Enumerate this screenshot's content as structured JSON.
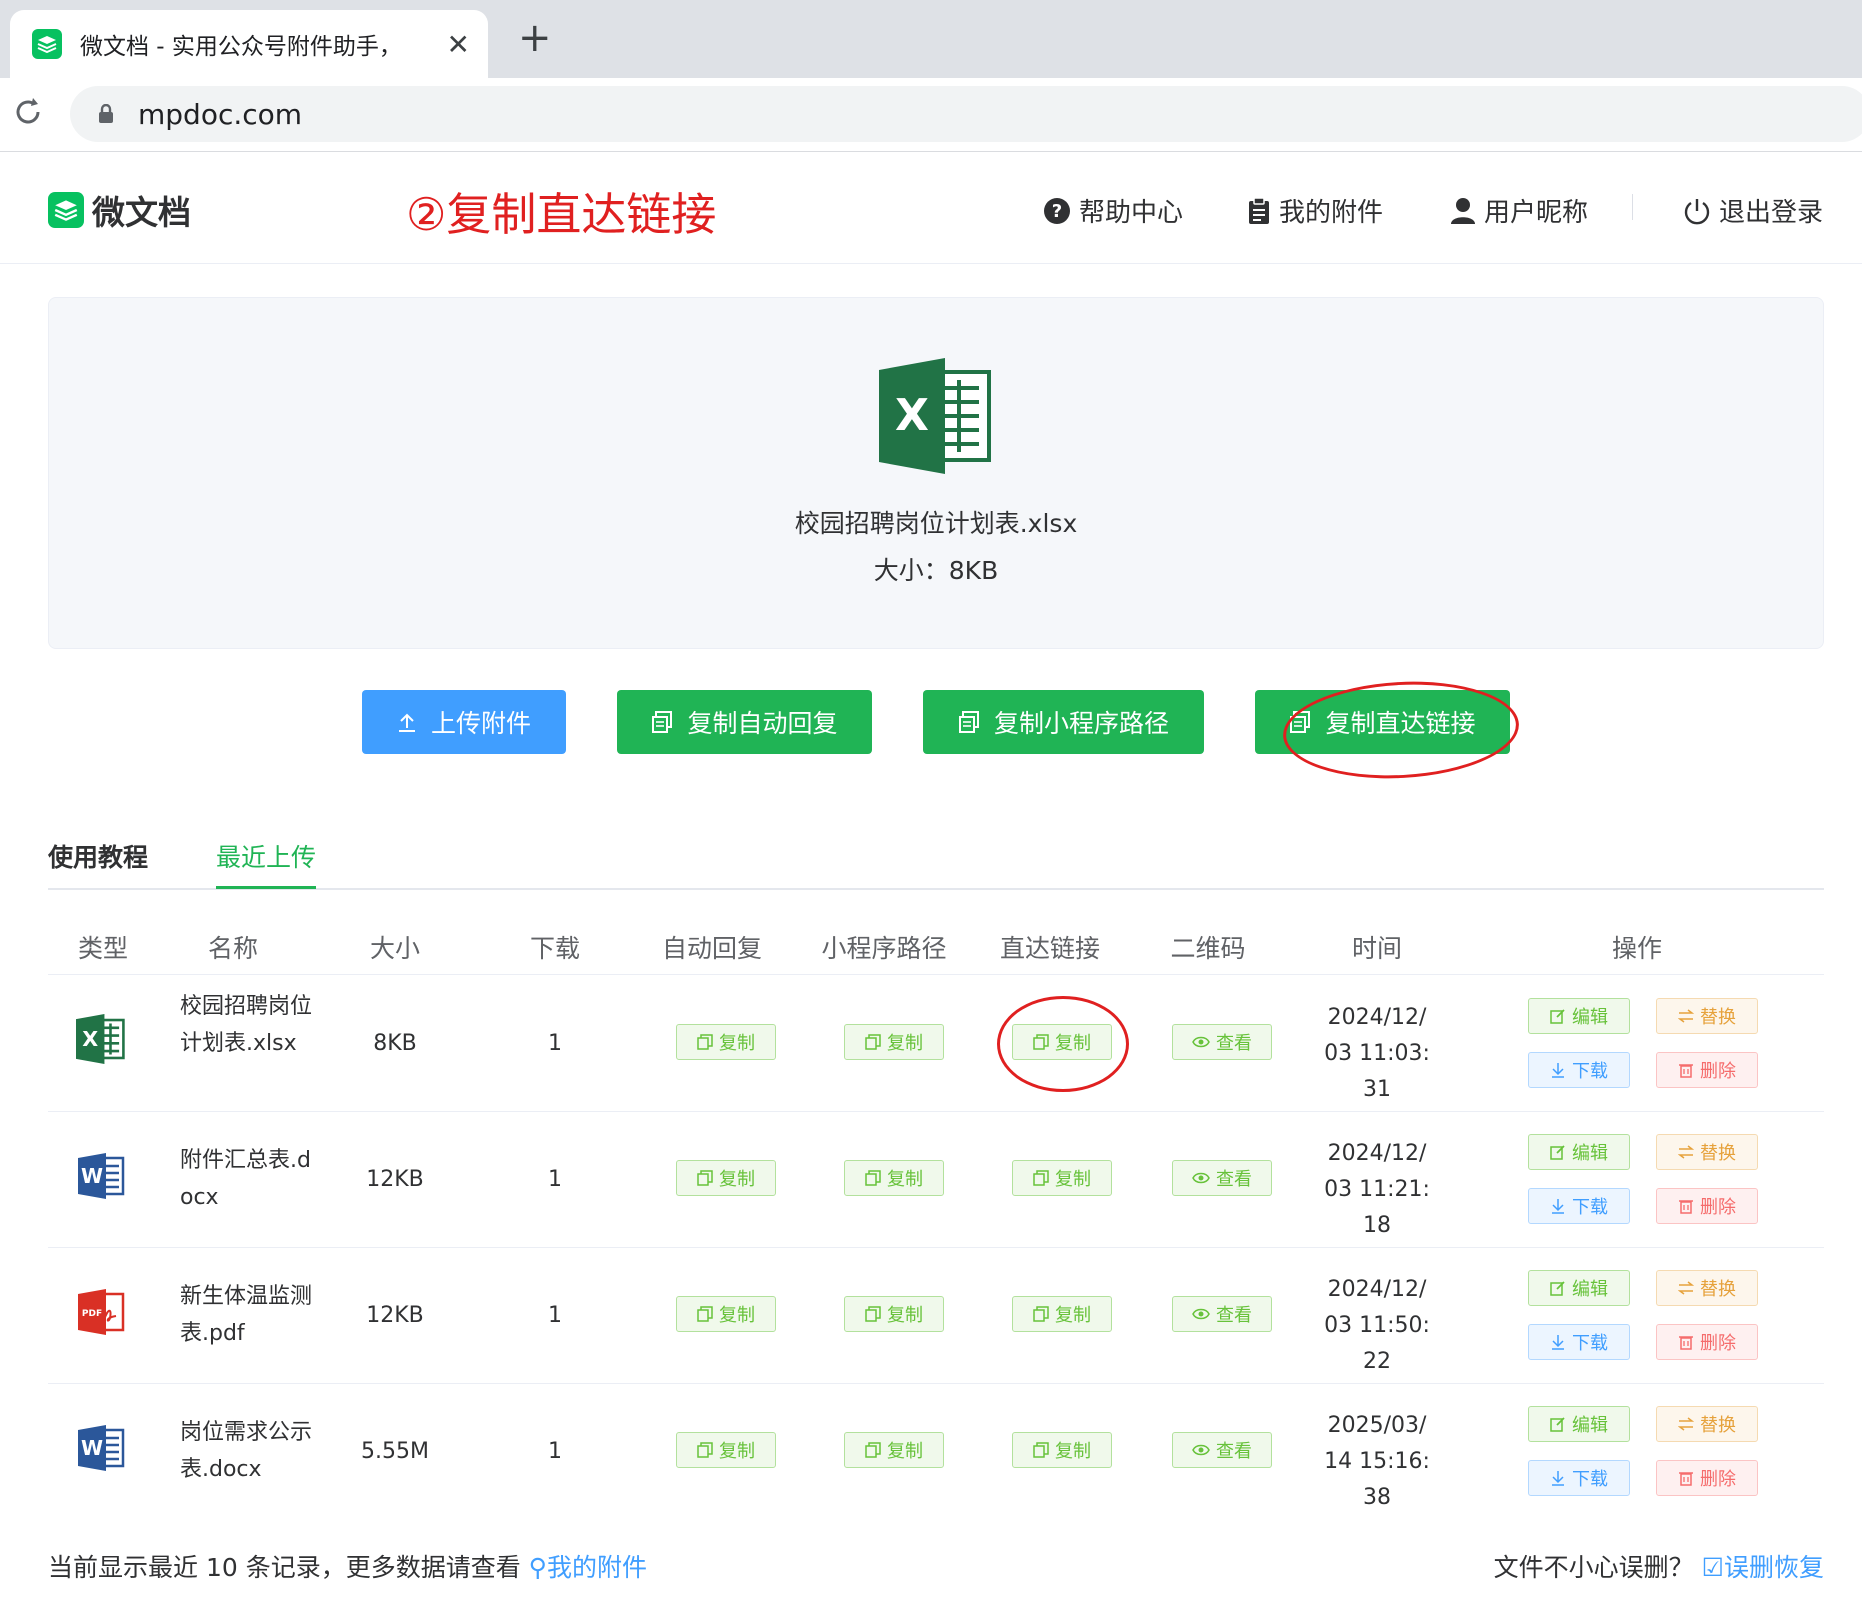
{
  "browser": {
    "tab_title": "微文档 - 实用公众号附件助手，",
    "tab_close": "✕",
    "new_tab": "+",
    "url": "mpdoc.com"
  },
  "header": {
    "logo_text": "微文档",
    "annotation": "②复制直达链接",
    "nav": [
      {
        "label": "帮助中心",
        "icon": "question-circle-icon"
      },
      {
        "label": "我的附件",
        "icon": "clipboard-icon"
      },
      {
        "label": "用户昵称",
        "icon": "user-icon"
      },
      {
        "label": "退出登录",
        "icon": "power-icon"
      }
    ]
  },
  "preview": {
    "file_name": "校园招聘岗位计划表.xlsx",
    "file_size": "大小：8KB",
    "icon": "excel-icon"
  },
  "actions": {
    "upload": "上传附件",
    "copy_auto_reply": "复制自动回复",
    "copy_mini_path": "复制小程序路径",
    "copy_direct_link": "复制直达链接"
  },
  "tabs": {
    "tutorial": "使用教程",
    "recent": "最近上传",
    "active": "recent"
  },
  "table": {
    "headers": [
      "类型",
      "名称",
      "大小",
      "下载",
      "自动回复",
      "小程序路径",
      "直达链接",
      "二维码",
      "时间",
      "操作"
    ],
    "copy_label": "复制",
    "view_label": "查看",
    "op_labels": {
      "edit": "编辑",
      "replace": "替换",
      "download": "下载",
      "delete": "删除"
    },
    "rows": [
      {
        "type": "xlsx",
        "name": "校园招聘岗位计划表.xlsx",
        "size": "8KB",
        "downloads": "1",
        "time": "2024/12/03 11:03:31"
      },
      {
        "type": "docx",
        "name": "附件汇总表.docx",
        "size": "12KB",
        "downloads": "1",
        "time": "2024/12/03 11:21:18"
      },
      {
        "type": "pdf",
        "name": "新生体温监测表.pdf",
        "size": "12KB",
        "downloads": "1",
        "time": "2024/12/03 11:50:22"
      },
      {
        "type": "docx",
        "name": "岗位需求公示表.docx",
        "size": "5.55M",
        "downloads": "1",
        "time": "2025/03/14 15:16:38"
      }
    ]
  },
  "footer": {
    "left_text": "当前显示最近 10 条记录，更多数据请查看",
    "left_link": "我的附件",
    "right_text": "文件不小心误删？",
    "right_link": "误删恢复"
  },
  "colors": {
    "brand_green": "#07c160",
    "button_green": "#20b455",
    "upload_blue": "#409eff",
    "annotation_red": "#e02020"
  }
}
